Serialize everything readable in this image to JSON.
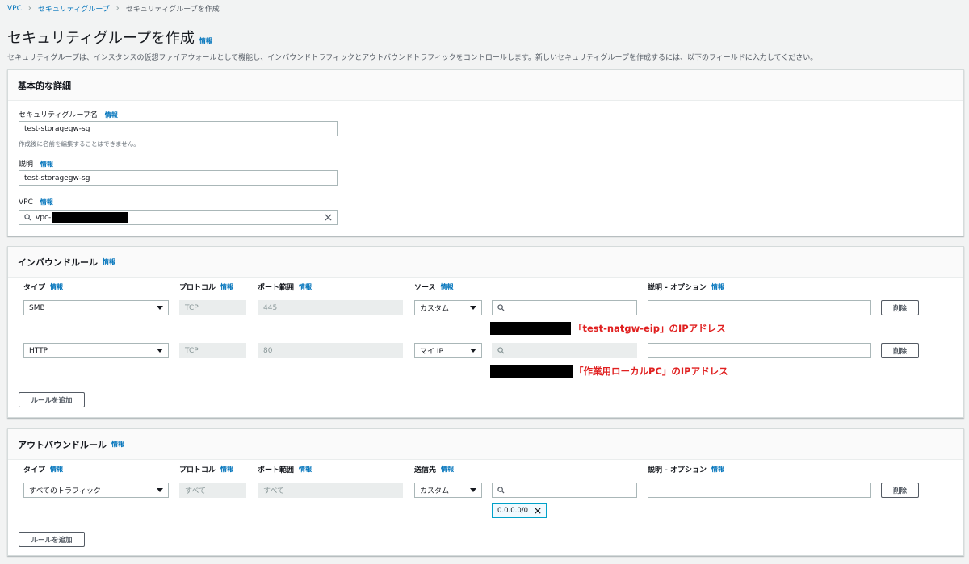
{
  "breadcrumb": [
    "VPC",
    "セキュリティグループ",
    "セキュリティグループを作成"
  ],
  "page": {
    "title": "セキュリティグループを作成",
    "info": "情報",
    "description": "セキュリティグループは、インスタンスの仮想ファイアウォールとして機能し、インバウンドトラフィックとアウトバウンドトラフィックをコントロールします。新しいセキュリティグループを作成するには、以下のフィールドに入力してください。"
  },
  "basic": {
    "header": "基本的な詳細",
    "name_label": "セキュリティグループ名",
    "name_value": "test-storagegw-sg",
    "name_hint": "作成後に名前を編集することはできません。",
    "desc_label": "説明",
    "desc_value": "test-storagegw-sg",
    "vpc_label": "VPC",
    "vpc_value": "vpc-"
  },
  "inbound": {
    "header": "インバウンドルール",
    "columns": {
      "type": "タイプ",
      "protocol": "プロトコル",
      "port": "ポート範囲",
      "source": "ソース",
      "desc": "説明 - オプション"
    },
    "rows": [
      {
        "type": "SMB",
        "protocol": "TCP",
        "port": "445",
        "source": "カスタム",
        "annotation": "「test-natgw-eip」のIPアドレス"
      },
      {
        "type": "HTTP",
        "protocol": "TCP",
        "port": "80",
        "source": "マイ IP",
        "annotation": "「作業用ローカルPC」のIPアドレス"
      }
    ],
    "delete_label": "削除",
    "add_rule_label": "ルールを追加"
  },
  "outbound": {
    "header": "アウトバウンドルール",
    "columns": {
      "type": "タイプ",
      "protocol": "プロトコル",
      "port": "ポート範囲",
      "dest": "送信先",
      "desc": "説明 - オプション"
    },
    "rows": [
      {
        "type": "すべてのトラフィック",
        "protocol": "すべて",
        "port": "すべて",
        "dest": "カスタム",
        "token": "0.0.0.0/0"
      }
    ],
    "delete_label": "削除",
    "add_rule_label": "ルールを追加"
  },
  "info": "情報",
  "colors": {
    "link": "#0073bb",
    "annotation": "#e02020",
    "background": "#f2f3f3"
  }
}
